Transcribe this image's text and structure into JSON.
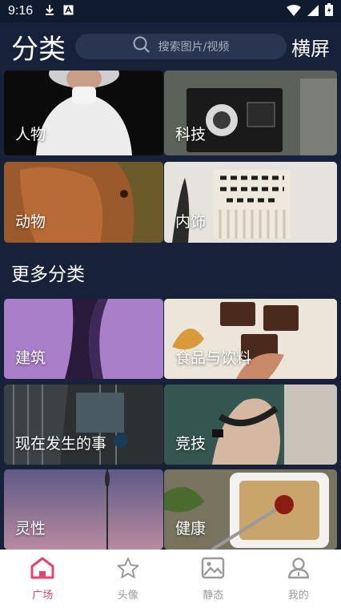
{
  "statusbar": {
    "time": "9:16"
  },
  "header": {
    "title": "分类",
    "search_placeholder": "搜索图片/视频",
    "landscape_label": "横屏"
  },
  "top_categories": [
    "人物",
    "科技",
    "动物",
    "内饰"
  ],
  "more_section": {
    "title": "更多分类"
  },
  "more_categories": [
    "建筑",
    "食品与饮料",
    "现在发生的事",
    "竞技",
    "灵性",
    "健康"
  ],
  "tabs": [
    {
      "label": "广场",
      "icon": "home-icon",
      "active": true
    },
    {
      "label": "头像",
      "icon": "star-icon",
      "active": false
    },
    {
      "label": "静态",
      "icon": "image-icon",
      "active": false
    },
    {
      "label": "我的",
      "icon": "person-icon",
      "active": false
    }
  ],
  "colors": {
    "background": "#17213a",
    "accent": "#e8436e",
    "tab_inactive": "#9a9a9a"
  }
}
